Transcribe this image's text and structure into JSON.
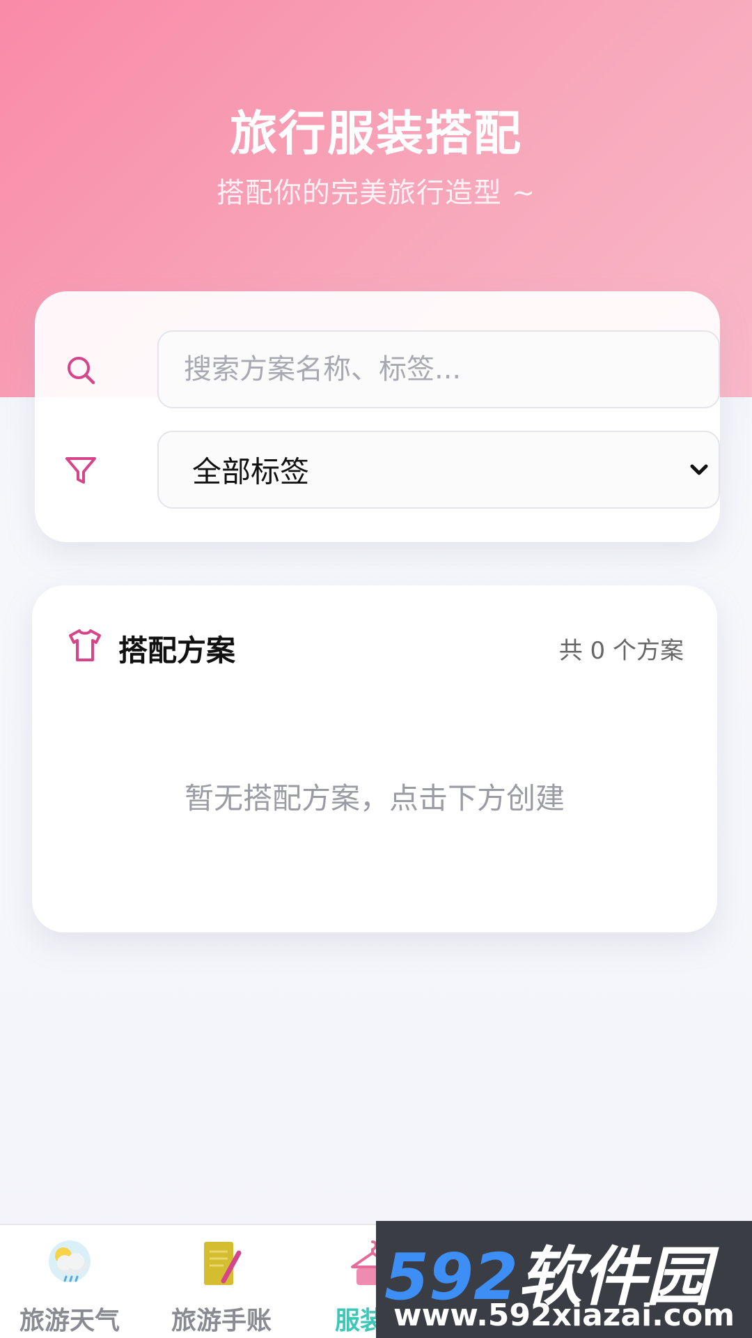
{
  "header": {
    "title": "旅行服装搭配",
    "subtitle": "搭配你的完美旅行造型 ~"
  },
  "filters": {
    "search_icon": "search-icon",
    "search_placeholder": "搜索方案名称、标签...",
    "search_value": "",
    "filter_icon": "filter-icon",
    "tag_select_value": "全部标签",
    "tag_select_chevron": "chevron-down-icon"
  },
  "plans": {
    "icon": "shirt-icon",
    "title": "搭配方案",
    "count_text": "共 0 个方案",
    "empty_text": "暂无搭配方案，点击下方创建"
  },
  "bottom_nav": {
    "items": [
      {
        "label": "旅游天气",
        "icon": "weather-icon",
        "active": false
      },
      {
        "label": "旅游手账",
        "icon": "notebook-pencil-icon",
        "active": false
      },
      {
        "label": "服装搭",
        "icon": "clothes-hanger-icon",
        "active": true
      }
    ]
  },
  "watermark": {
    "logo_number": "592",
    "logo_text": "软件园",
    "url": "www.592xiazai.com"
  },
  "colors": {
    "header_pink": "#f98aa8",
    "accent_pink": "#d6458a",
    "active_teal": "#3cc7b7",
    "watermark_blue": "#3d8ef5"
  }
}
